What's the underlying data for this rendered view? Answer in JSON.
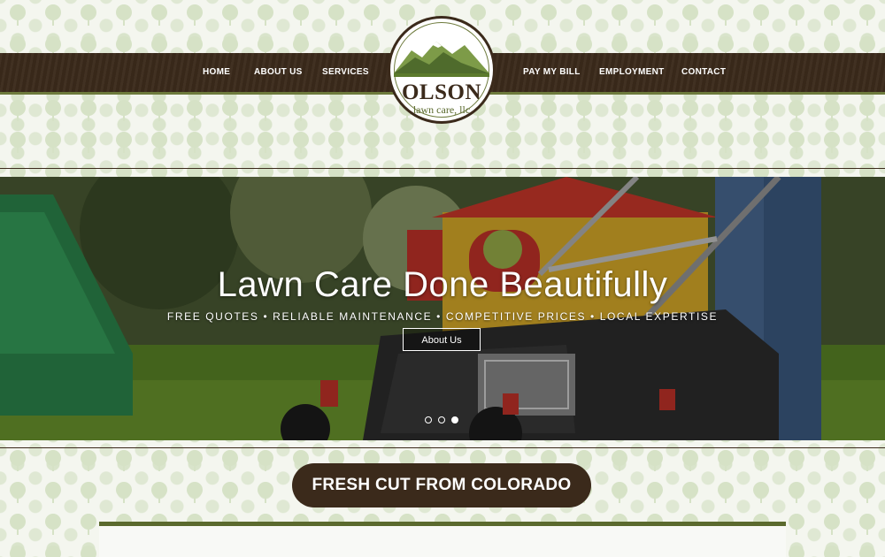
{
  "nav": {
    "left": [
      {
        "label": "HOME"
      },
      {
        "label": "ABOUT US"
      },
      {
        "label": "SERVICES"
      }
    ],
    "right": [
      {
        "label": "PAY MY BILL"
      },
      {
        "label": "EMPLOYMENT"
      },
      {
        "label": "CONTACT"
      }
    ]
  },
  "logo": {
    "name": "OLSON",
    "sub": "lawn care, llc"
  },
  "hero": {
    "title": "Lawn Care Done Beautifully",
    "subtitle": "FREE QUOTES • RELIABLE MAINTENANCE • COMPETITIVE PRICES • LOCAL EXPERTISE",
    "button_label": "About Us",
    "slides": 3,
    "active_slide": 3
  },
  "section": {
    "heading": "FRESH CUT FROM COLORADO"
  },
  "colors": {
    "brown": "#3b2a1b",
    "olive": "#5b6a2e",
    "pattern_green": "#d9e4cb"
  }
}
